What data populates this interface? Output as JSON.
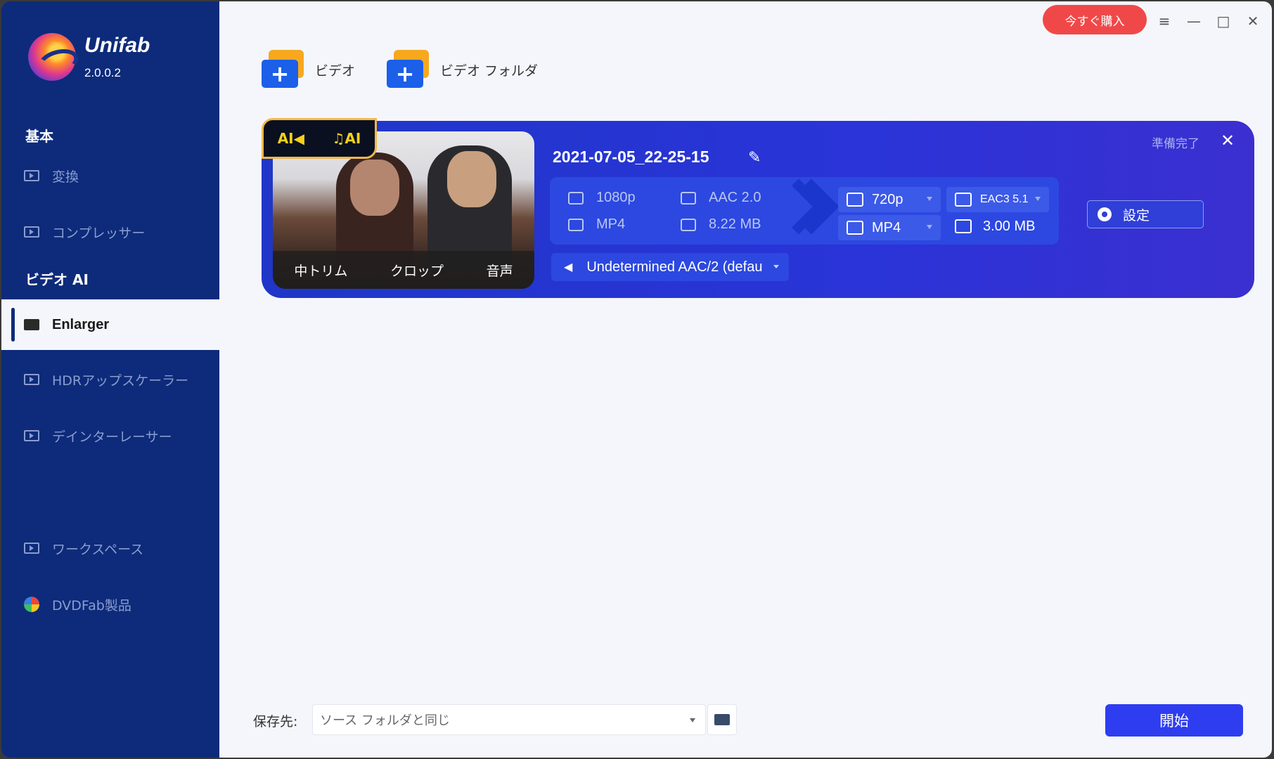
{
  "app": {
    "brand": "Unifab",
    "version": "2.0.0.2"
  },
  "sidebar": {
    "section_basic": "基本",
    "item_convert": "変換",
    "item_compressor": "コンプレッサー",
    "section_video_ai": "ビデオ AI",
    "item_enlarger": "Enlarger",
    "item_hdr": "HDRアップスケーラー",
    "item_deinterlacer": "デインターレーサー",
    "item_workspace": "ワークスペース",
    "item_dvdfab": "DVDFab製品"
  },
  "topbar": {
    "buy_label": "今すぐ購入",
    "menu_icon": "≡",
    "minimize_icon": "—",
    "maximize_icon": "□",
    "close_icon": "✕",
    "add_video_label": "ビデオ",
    "add_folder_label": "ビデオ フォルダ"
  },
  "task": {
    "filename": "2021-07-05_22-25-15",
    "status": "準備完了",
    "ai_tag_left": "AI◀",
    "ai_tag_right": "♫AI",
    "trim_label": "中トリム",
    "crop_label": "クロップ",
    "audio_label": "音声",
    "source": {
      "resolution": "1080p",
      "audio": "AAC 2.0",
      "format": "MP4",
      "size": "8.22 MB"
    },
    "output": {
      "resolution": "720p",
      "audio": "EAC3 5.1",
      "format": "MP4",
      "size": "3.00 MB"
    },
    "settings_label": "設定",
    "audio_track": "Undetermined AAC/2 (defau"
  },
  "bottom": {
    "save_label": "保存先:",
    "save_value": "ソース フォルダと同じ",
    "start_label": "開始"
  },
  "colors": {
    "sidebar": "#0d2b7a",
    "accent": "#2f3df0",
    "buy": "#f04848",
    "card": "#2a34d8"
  }
}
